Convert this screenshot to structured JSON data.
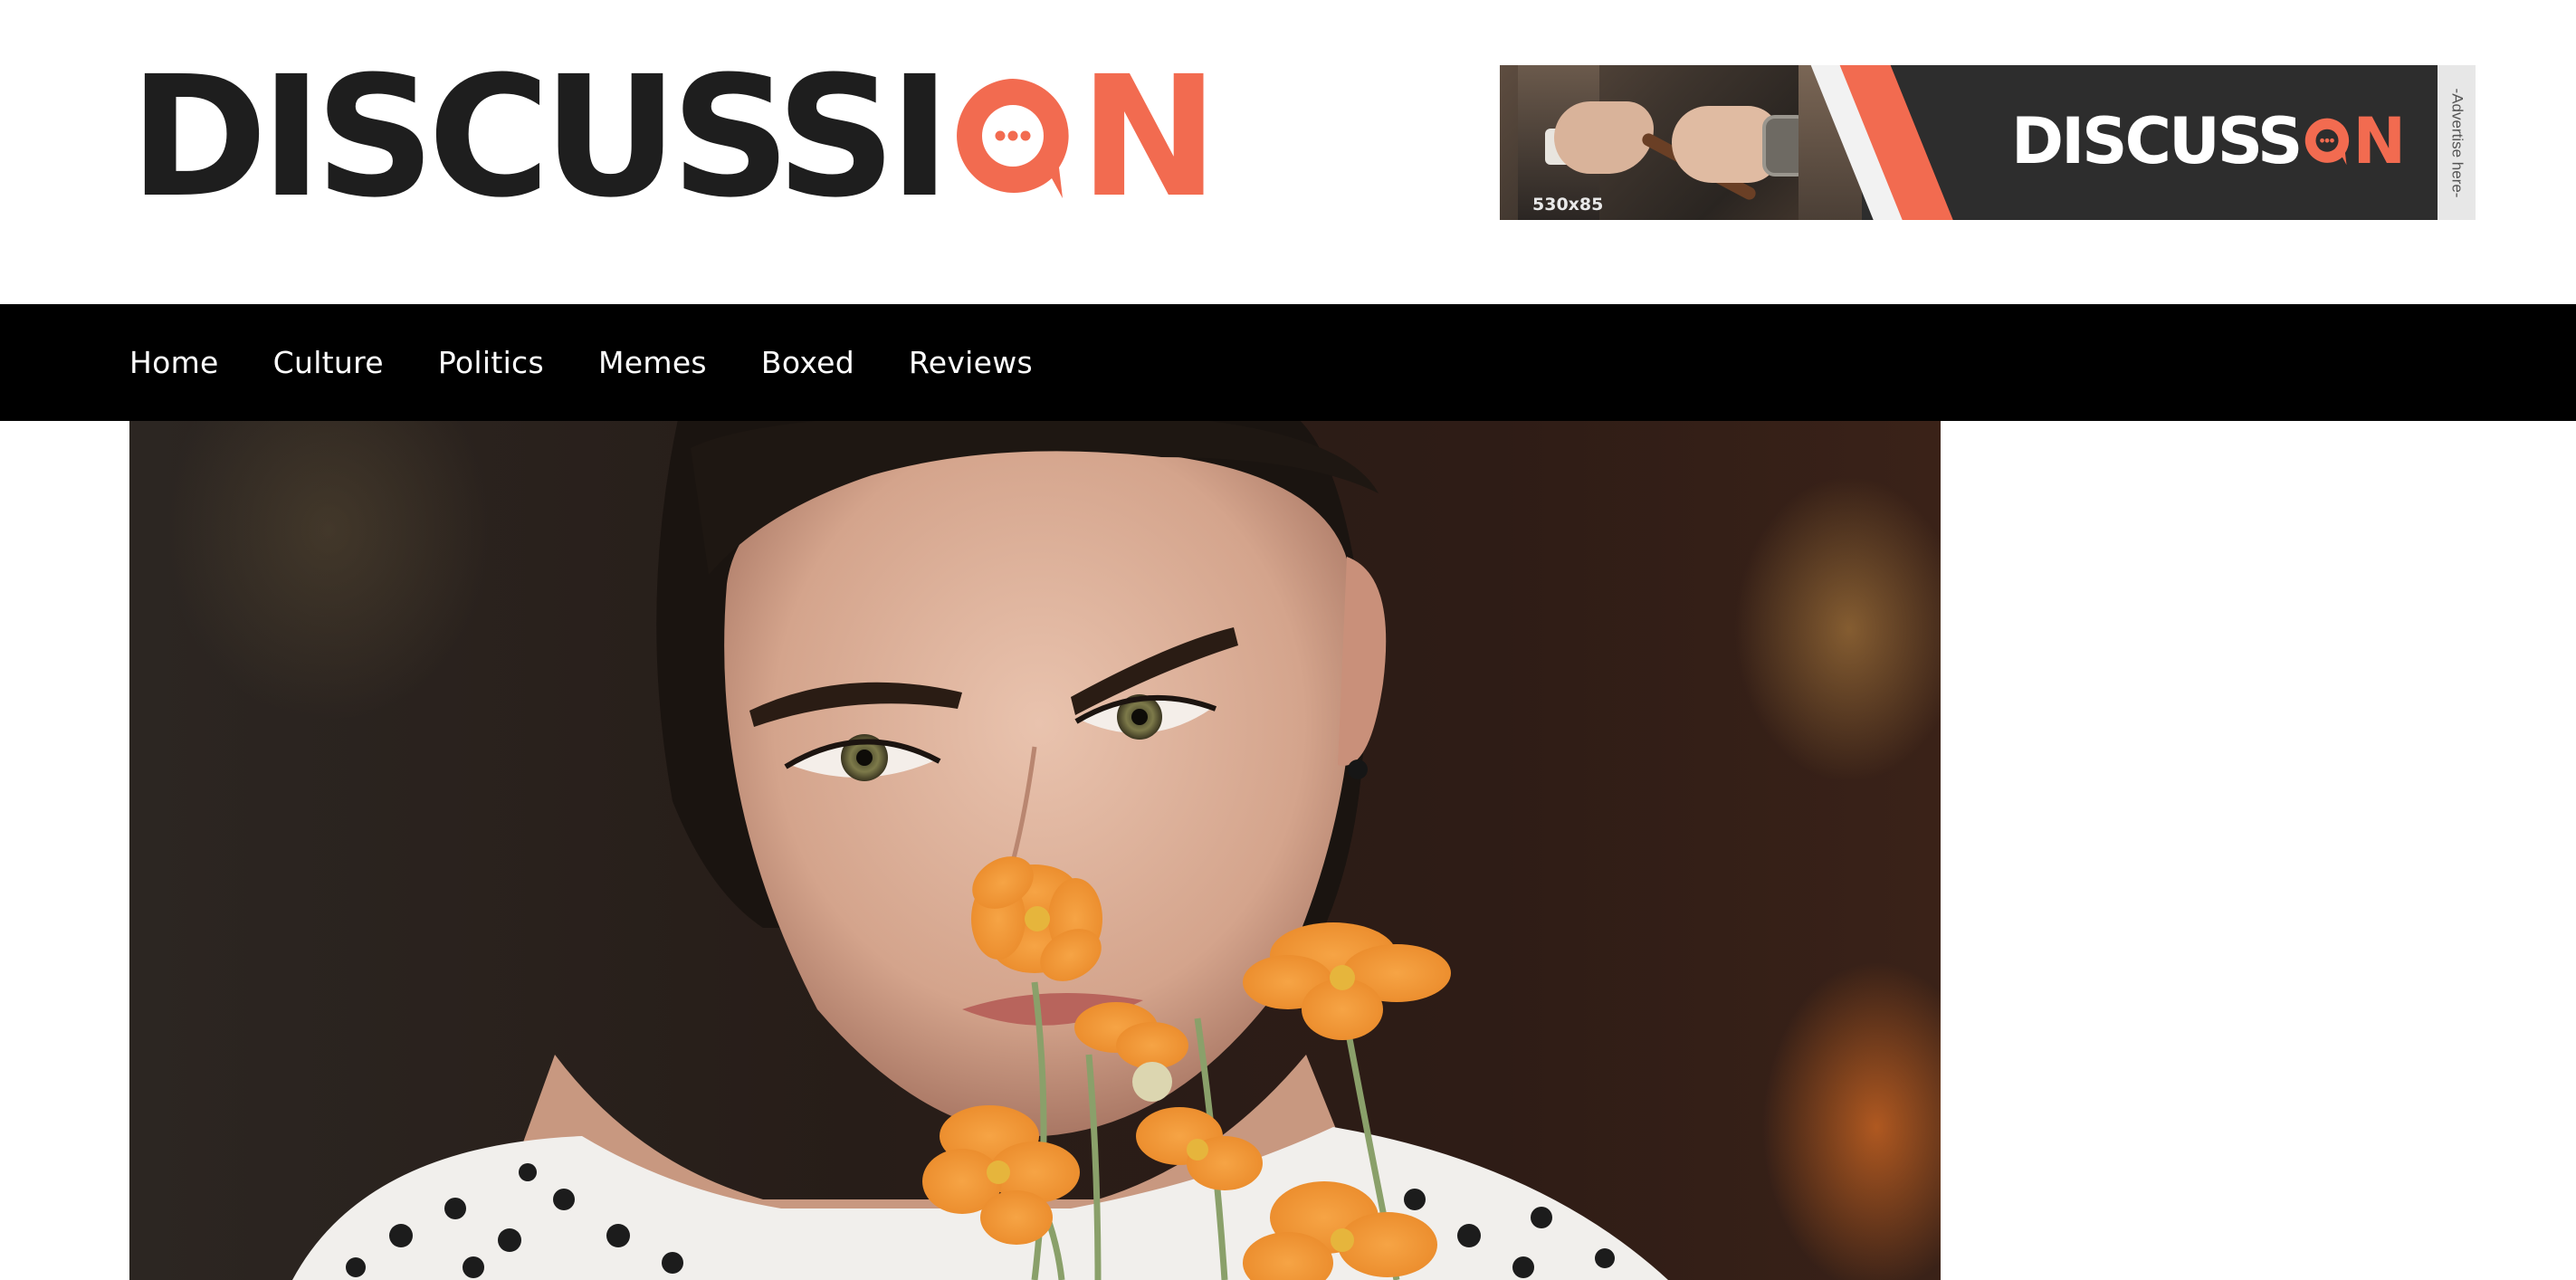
{
  "header": {
    "logo": {
      "part1": "DISCUSSI",
      "part2": "N"
    },
    "ad": {
      "size_label": "530x85",
      "logo": {
        "part1": "DISCUSS",
        "part2": "N"
      },
      "side_label": "-Advertise here-"
    }
  },
  "nav": {
    "items": [
      {
        "label": "Home"
      },
      {
        "label": "Culture"
      },
      {
        "label": "Politics"
      },
      {
        "label": "Memes"
      },
      {
        "label": "Boxed"
      },
      {
        "label": "Reviews"
      }
    ]
  },
  "colors": {
    "accent": "#f26b50",
    "logo_dark": "#1e1e1e",
    "nav_background": "#000000",
    "nav_text": "#ffffff"
  }
}
